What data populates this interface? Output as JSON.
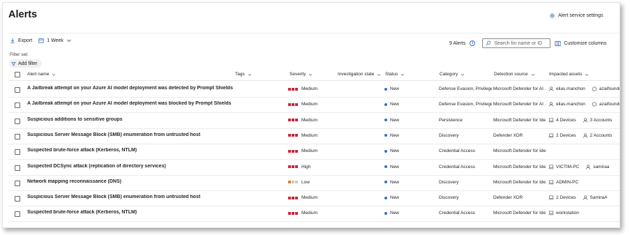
{
  "page": {
    "title": "Alerts",
    "settings_label": "Alert service settings"
  },
  "toolbar": {
    "export_label": "Export",
    "range_label": "1 Week",
    "count_label": "9 Alerts",
    "search_placeholder": "Search for name or ID",
    "customize_label": "Customize columns"
  },
  "filters": {
    "filter_set_label": "Filter set:",
    "add_filter_label": "Add filter"
  },
  "columns": [
    "Alert name",
    "Tags",
    "Severity",
    "Investigation state",
    "Status",
    "Category",
    "Detection source",
    "Impacted assets"
  ],
  "colors": {
    "sev_medium": "#c5283d",
    "sev_low_a": "#e07b39",
    "sev_low_b": "#c8c8c8",
    "status_dot": "#2e6fc9"
  },
  "rows": [
    {
      "name": "A Jailbreak attempt on your Azure AI model deployment was detected by Prompt Shields",
      "severity": "Medium",
      "status": "New",
      "category": "Defense Evasion, Privilege ...",
      "source": "Microsoft Defender for AI ...",
      "assets": [
        {
          "icon": "user-icon",
          "label": "elias.manchon"
        },
        {
          "icon": "cloud-resource-icon",
          "label": "azaifoundry-mdl"
        }
      ]
    },
    {
      "name": "A Jailbreak attempt on your Azure AI model deployment was blocked by Prompt Shields",
      "severity": "Medium",
      "status": "New",
      "category": "Defense Evasion, Privilege ...",
      "source": "Microsoft Defender for AI ...",
      "assets": [
        {
          "icon": "user-icon",
          "label": "elias.manchon"
        },
        {
          "icon": "cloud-resource-icon",
          "label": "azaifoundry-mdl"
        }
      ]
    },
    {
      "name": "Suspicious additions to sensitive groups",
      "severity": "Medium",
      "status": "New",
      "category": "Persistence",
      "source": "Microsoft Defender for Ide...",
      "assets": [
        {
          "icon": "device-icon",
          "label": "4 Devices"
        },
        {
          "icon": "user-icon",
          "label": "3 Accounts"
        }
      ]
    },
    {
      "name": "Suspicious Server Message Block (SMB) enumeration from untrusted host",
      "severity": "Medium",
      "status": "New",
      "category": "Discovery",
      "source": "Defender XDR",
      "assets": [
        {
          "icon": "device-icon",
          "label": "2 Devices"
        },
        {
          "icon": "user-icon",
          "label": "2 Accounts"
        }
      ]
    },
    {
      "name": "Suspected brute-force attack (Kerberos, NTLM)",
      "severity": "Medium",
      "status": "New",
      "category": "Credential Access",
      "source": "Microsoft Defender for Ide...",
      "assets": []
    },
    {
      "name": "Suspected DCSync attack (replication of directory services)",
      "severity": "High",
      "status": "New",
      "category": "Credential Access",
      "source": "Microsoft Defender for Ide...",
      "assets": [
        {
          "icon": "device-icon",
          "label": "VICTIM-PC"
        },
        {
          "icon": "user-icon",
          "label": "samiraa"
        }
      ]
    },
    {
      "name": "Network mapping reconnaissance (DNS)",
      "severity": "Low",
      "status": "New",
      "category": "Discovery",
      "source": "Microsoft Defender for Ide...",
      "assets": [
        {
          "icon": "device-icon",
          "label": "ADMIN-PC"
        }
      ]
    },
    {
      "name": "Suspicious Server Message Block (SMB) enumeration from untrusted host",
      "severity": "Medium",
      "status": "New",
      "category": "Discovery",
      "source": "Defender XDR",
      "assets": [
        {
          "icon": "device-icon",
          "label": "2 Devices"
        },
        {
          "icon": "user-icon",
          "label": "SamiraA"
        }
      ]
    },
    {
      "name": "Suspected brute-force attack (Kerberos, NTLM)",
      "severity": "Medium",
      "status": "New",
      "category": "Credential Access",
      "source": "Microsoft Defender for Ide...",
      "assets": [
        {
          "icon": "device-icon",
          "label": "workstation"
        }
      ]
    }
  ]
}
